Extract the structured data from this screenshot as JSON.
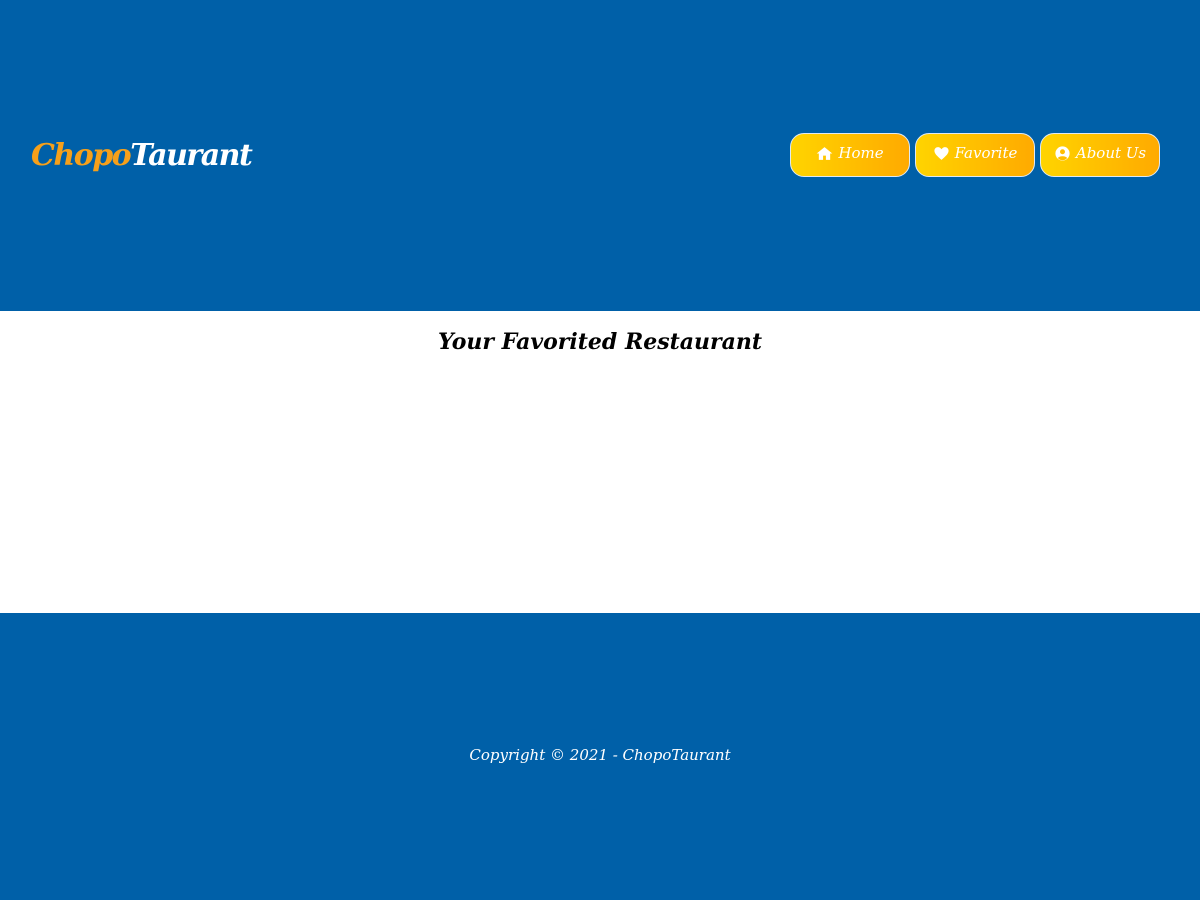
{
  "header": {
    "brand_part1": "Chopo",
    "brand_part2": "Taurant",
    "nav": [
      {
        "label": "Home",
        "icon": "home-icon"
      },
      {
        "label": "Favorite",
        "icon": "heart-icon"
      },
      {
        "label": "About Us",
        "icon": "user-circle-icon"
      }
    ]
  },
  "main": {
    "title": "Your Favorited Restaurant"
  },
  "footer": {
    "copyright": "Copyright © 2021 - ChopoTaurant"
  },
  "colors": {
    "primary": "#0060a8",
    "accent": "#f6a01a",
    "button_gradient_start": "#ffd400",
    "button_gradient_end": "#ffaa00"
  }
}
